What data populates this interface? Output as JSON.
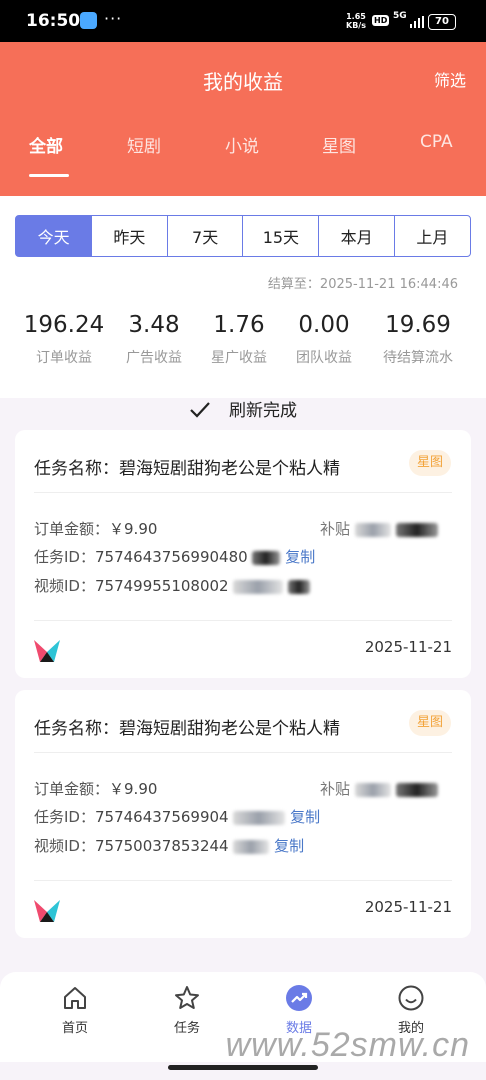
{
  "status_bar": {
    "time": "16:50",
    "more": "···",
    "net_speed": "1.65\nKB/s",
    "hd": "HD",
    "network": "5G",
    "battery": "70"
  },
  "header": {
    "title": "我的收益",
    "filter_label": "筛选",
    "bg_color": "#f66f58"
  },
  "tabs": [
    {
      "label": "全部",
      "active": true
    },
    {
      "label": "短剧",
      "active": false
    },
    {
      "label": "小说",
      "active": false
    },
    {
      "label": "星图",
      "active": false
    },
    {
      "label": "CPA",
      "active": false
    }
  ],
  "periods": [
    {
      "label": "今天",
      "active": true
    },
    {
      "label": "昨天",
      "active": false
    },
    {
      "label": "7天",
      "active": false
    },
    {
      "label": "15天",
      "active": false
    },
    {
      "label": "本月",
      "active": false
    },
    {
      "label": "上月",
      "active": false
    }
  ],
  "settle_time": "结算至：2025-11-21 16:44:46",
  "stats": [
    {
      "value": "196.24",
      "label": "订单收益"
    },
    {
      "value": "3.48",
      "label": "广告收益"
    },
    {
      "value": "1.76",
      "label": "星广收益"
    },
    {
      "value": "0.00",
      "label": "团队收益"
    },
    {
      "value": "19.69",
      "label": "待结算流水"
    }
  ],
  "refresh_text": "刷新完成",
  "cards": [
    {
      "title": "任务名称：碧海短剧甜狗老公是个粘人精",
      "tag": "星图",
      "order_amount_label": "订单金额：",
      "order_amount": "￥9.90",
      "subsidy_label": "补贴",
      "task_id_label": "任务ID：",
      "task_id": "7574643756990480",
      "task_copy": "复制",
      "video_id_label": "视频ID：",
      "video_id": "75749955108002",
      "date": "2025-11-21"
    },
    {
      "title": "任务名称：碧海短剧甜狗老公是个粘人精",
      "tag": "星图",
      "order_amount_label": "订单金额：",
      "order_amount": "￥9.90",
      "subsidy_label": "补贴",
      "task_id_label": "任务ID：",
      "task_id": "75746437569904",
      "task_copy": "复制",
      "video_id_label": "视频ID：",
      "video_id": "75750037853244",
      "video_copy": "复制",
      "date": "2025-11-21"
    }
  ],
  "nav": [
    {
      "label": "首页",
      "icon": "home-icon",
      "active": false
    },
    {
      "label": "任务",
      "icon": "star-icon",
      "active": false
    },
    {
      "label": "数据",
      "icon": "trend-icon",
      "active": true
    },
    {
      "label": "我的",
      "icon": "smile-icon",
      "active": false
    }
  ],
  "watermark": "www.52smw.cn",
  "accent_color": "#6a7be6"
}
